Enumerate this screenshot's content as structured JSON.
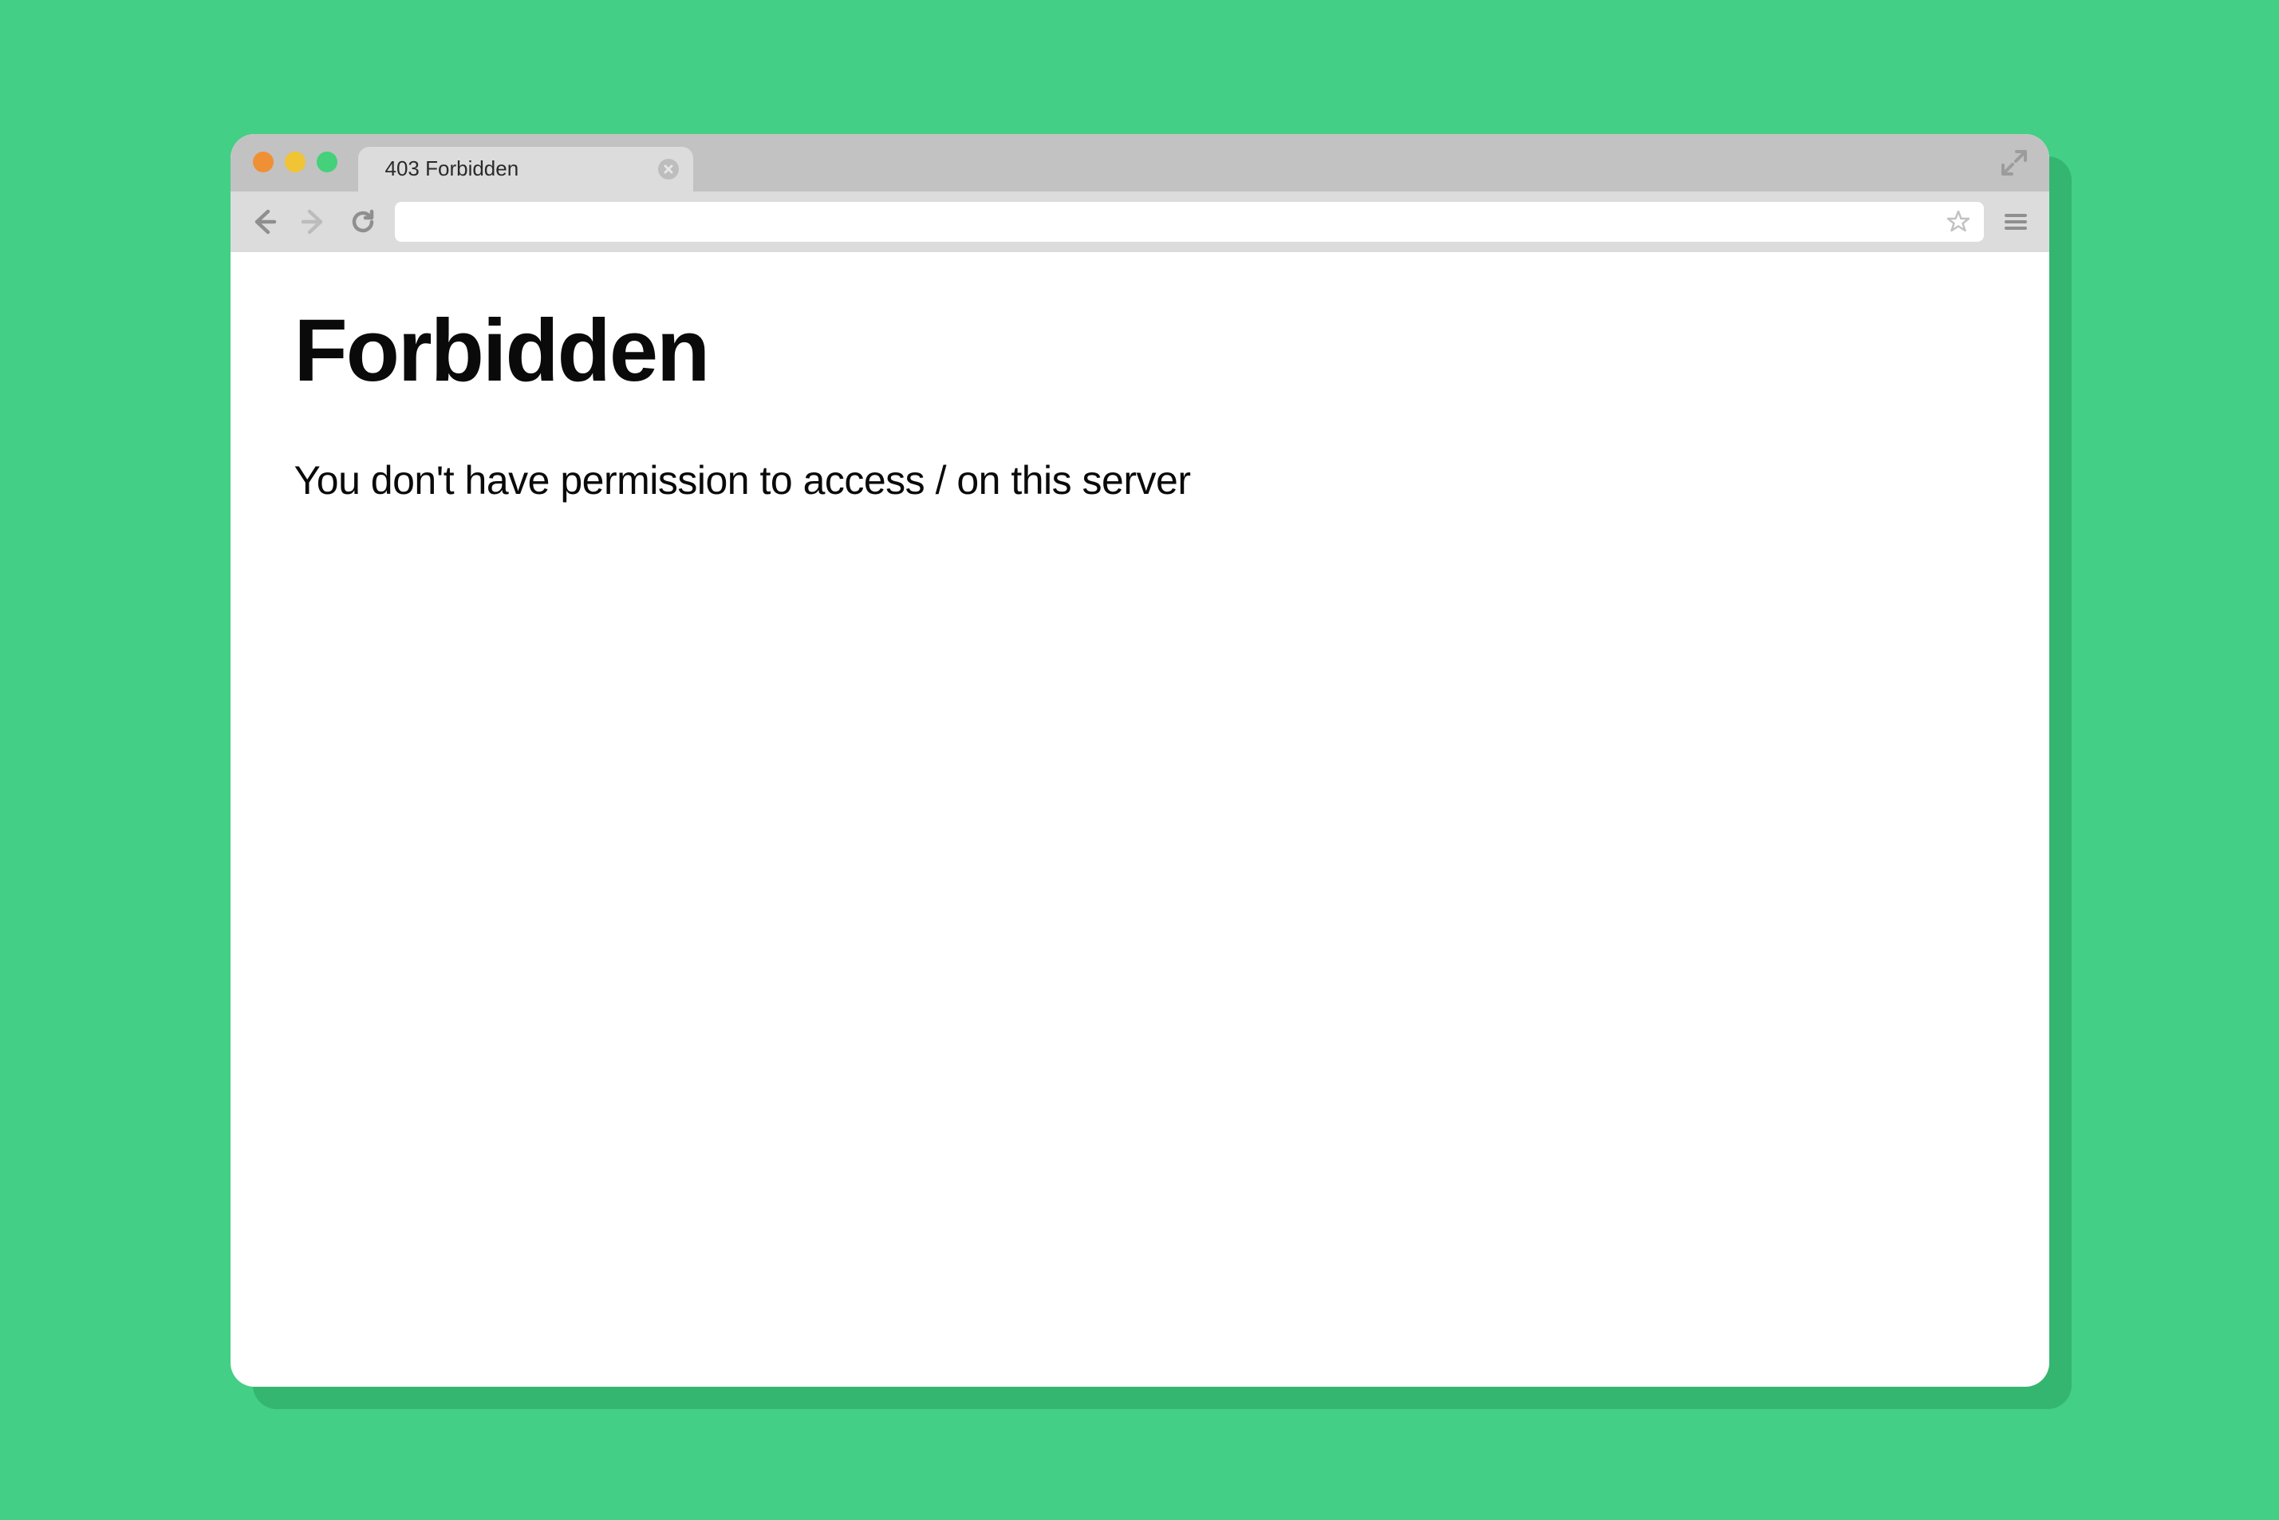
{
  "window": {
    "tabs": [
      {
        "title": "403 Forbidden",
        "active": true
      },
      {
        "title": "",
        "active": false
      }
    ]
  },
  "toolbar": {
    "address_value": ""
  },
  "page": {
    "heading": "Forbidden",
    "message": "You don't have permission to access / on this server"
  },
  "icons": {
    "close": "close-icon",
    "expand": "expand-icon",
    "back": "back-icon",
    "forward": "forward-icon",
    "reload": "reload-icon",
    "star": "star-icon",
    "menu": "menu-icon"
  }
}
